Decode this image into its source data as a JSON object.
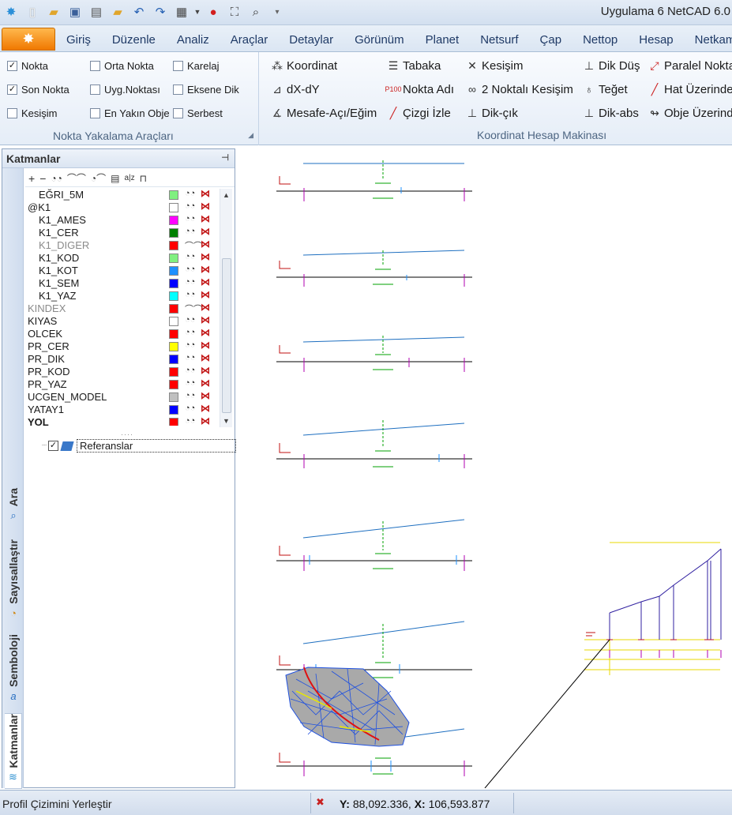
{
  "window": {
    "title": "Uygulama 6 NetCAD 6.0"
  },
  "quick_access": [
    "app-logo-icon",
    "new-file-icon",
    "open-folder-icon",
    "save-icon",
    "print-icon",
    "folder-icon",
    "undo-icon",
    "redo-icon",
    "layout-icon",
    "dropdown-arrow-icon",
    "help-icon",
    "fit-view-icon",
    "zoom-icon",
    "customize-icon"
  ],
  "menu": {
    "tabs": [
      "Giriş",
      "Düzenle",
      "Analiz",
      "Araçlar",
      "Detaylar",
      "Görünüm",
      "Planet",
      "Netsurf",
      "Çap",
      "Nettop",
      "Hesap",
      "Netkam"
    ]
  },
  "snap_group": {
    "label": "Nokta Yakalama Araçları",
    "items": [
      {
        "label": "Nokta",
        "checked": true
      },
      {
        "label": "Son Nokta",
        "checked": true
      },
      {
        "label": "Kesişim",
        "checked": false
      },
      {
        "label": "Orta Nokta",
        "checked": false
      },
      {
        "label": "Uyg.Noktası",
        "checked": false
      },
      {
        "label": "En Yakın Obje",
        "checked": false
      },
      {
        "label": "Karelaj",
        "checked": false
      },
      {
        "label": "Eksene Dik",
        "checked": false
      },
      {
        "label": "Serbest",
        "checked": false
      }
    ]
  },
  "calc_group": {
    "label": "Koordinat Hesap Makinası",
    "items": [
      "Koordinat",
      "dX-dY",
      "Mesafe-Açı/Eğim",
      "Tabaka",
      "Nokta Adı",
      "Çizgi İzle",
      "Kesişim",
      "2 Noktalı Kesişim",
      "Dik-çık",
      "Dik Düş",
      "Teğet",
      "Dik-abs",
      "Paralel Nokta",
      "Hat Üzerinde",
      "Obje Üzerinde"
    ]
  },
  "layers_panel": {
    "title": "Katmanlar",
    "layers": [
      {
        "name": "EĞRI_5M",
        "color": "#80f080",
        "indent": true,
        "dim": false,
        "bold": false
      },
      {
        "name": "@K1",
        "color": "#ffffff",
        "indent": false,
        "dim": false,
        "bold": false
      },
      {
        "name": "K1_AMES",
        "color": "#ff00ff",
        "indent": true,
        "dim": false,
        "bold": false
      },
      {
        "name": "K1_CER",
        "color": "#008000",
        "indent": true,
        "dim": false,
        "bold": false
      },
      {
        "name": "K1_DIGER",
        "color": "#ff0000",
        "indent": true,
        "dim": true,
        "bold": false
      },
      {
        "name": "K1_KOD",
        "color": "#80f080",
        "indent": true,
        "dim": false,
        "bold": false
      },
      {
        "name": "K1_KOT",
        "color": "#1e90ff",
        "indent": true,
        "dim": false,
        "bold": false
      },
      {
        "name": "K1_SEM",
        "color": "#0000ff",
        "indent": true,
        "dim": false,
        "bold": false
      },
      {
        "name": "K1_YAZ",
        "color": "#00ffff",
        "indent": true,
        "dim": false,
        "bold": false
      },
      {
        "name": "KINDEX",
        "color": "#ff0000",
        "indent": false,
        "dim": true,
        "bold": false
      },
      {
        "name": "KIYAS",
        "color": "#ffffff",
        "indent": false,
        "dim": false,
        "bold": false
      },
      {
        "name": "OLCEK",
        "color": "#ff0000",
        "indent": false,
        "dim": false,
        "bold": false
      },
      {
        "name": "PR_CER",
        "color": "#ffff00",
        "indent": false,
        "dim": false,
        "bold": false
      },
      {
        "name": "PR_DIK",
        "color": "#0000ff",
        "indent": false,
        "dim": false,
        "bold": false
      },
      {
        "name": "PR_KOD",
        "color": "#ff0000",
        "indent": false,
        "dim": false,
        "bold": false
      },
      {
        "name": "PR_YAZ",
        "color": "#ff0000",
        "indent": false,
        "dim": false,
        "bold": false
      },
      {
        "name": "UCGEN_MODEL",
        "color": "#c0c0c0",
        "indent": false,
        "dim": false,
        "bold": false
      },
      {
        "name": "YATAY1",
        "color": "#0000ff",
        "indent": false,
        "dim": false,
        "bold": false
      },
      {
        "name": "YOL",
        "color": "#ff0000",
        "indent": false,
        "dim": false,
        "bold": true
      }
    ],
    "reference": {
      "label": "Referanslar",
      "checked": true
    },
    "side_tabs": [
      "Ara",
      "Sayısallaştır",
      "Semboloji",
      "Katmanlar"
    ]
  },
  "status": {
    "message": "Profil Çizimini Yerleştir",
    "y_label": "Y:",
    "y_value": "88,092.336,",
    "x_label": "X:",
    "x_value": "106,593.877"
  }
}
